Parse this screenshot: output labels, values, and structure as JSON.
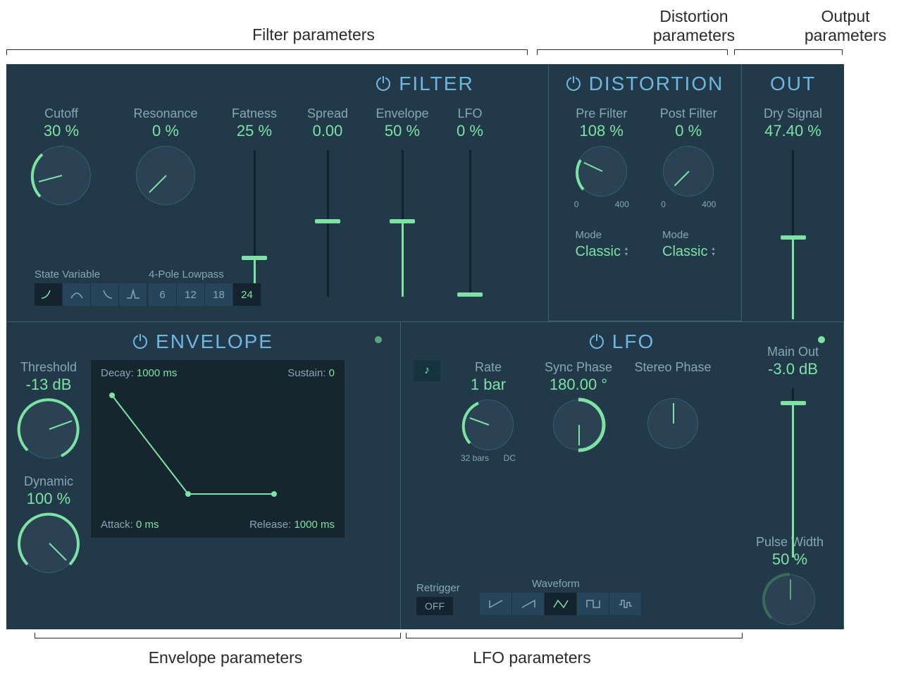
{
  "annotations": {
    "filter": "Filter parameters",
    "distortion": "Distortion parameters",
    "output": "Output parameters",
    "envelope": "Envelope parameters",
    "lfo": "LFO parameters"
  },
  "filter": {
    "title": "FILTER",
    "cutoff": {
      "label": "Cutoff",
      "value": "30 %",
      "pct": 30
    },
    "resonance": {
      "label": "Resonance",
      "value": "0 %",
      "pct": 0
    },
    "state_variable_label": "State Variable",
    "pole_label": "4-Pole Lowpass",
    "poles": [
      "6",
      "12",
      "18",
      "24"
    ],
    "selected_pole": "24",
    "fatness": {
      "label": "Fatness",
      "value": "25 %",
      "pct": 25
    },
    "spread": {
      "label": "Spread",
      "value": "0.00",
      "pct": 50
    },
    "envelope": {
      "label": "Envelope",
      "value": "50 %",
      "pct": 50
    },
    "lfo": {
      "label": "LFO",
      "value": "0 %",
      "pct": 0
    }
  },
  "distortion": {
    "title": "DISTORTION",
    "pre": {
      "label": "Pre Filter",
      "value": "108 %",
      "pct": 27,
      "scale_lo": "0",
      "scale_hi": "400"
    },
    "post": {
      "label": "Post Filter",
      "value": "0 %",
      "pct": 0,
      "scale_lo": "0",
      "scale_hi": "400"
    },
    "mode_label": "Mode",
    "mode_pre": "Classic",
    "mode_post": "Classic"
  },
  "out": {
    "title": "OUT",
    "dry": {
      "label": "Dry Signal",
      "value": "47.40 %",
      "pct": 47
    },
    "main": {
      "label": "Main Out",
      "value": "-3.0 dB",
      "pct": 90
    }
  },
  "envelope": {
    "title": "ENVELOPE",
    "threshold": {
      "label": "Threshold",
      "value": "-13 dB",
      "pct": 70
    },
    "dynamic": {
      "label": "Dynamic",
      "value": "100 %",
      "pct": 100
    },
    "decay_label": "Decay:",
    "decay": "1000 ms",
    "sustain_label": "Sustain:",
    "sustain": "0",
    "attack_label": "Attack:",
    "attack": "0 ms",
    "release_label": "Release:",
    "release": "1000 ms"
  },
  "lfo": {
    "title": "LFO",
    "rate": {
      "label": "Rate",
      "value": "1 bar",
      "pct": 50,
      "scale_lo": "32 bars",
      "scale_hi": "DC"
    },
    "sync_phase": {
      "label": "Sync Phase",
      "value": "180.00 °",
      "pct": 100
    },
    "stereo_phase": {
      "label": "Stereo Phase",
      "value": "",
      "pct": 50
    },
    "pulse_width": {
      "label": "Pulse Width",
      "value": "50 %",
      "pct": 50
    },
    "retrigger_label": "Retrigger",
    "retrigger": "OFF",
    "waveform_label": "Waveform"
  }
}
